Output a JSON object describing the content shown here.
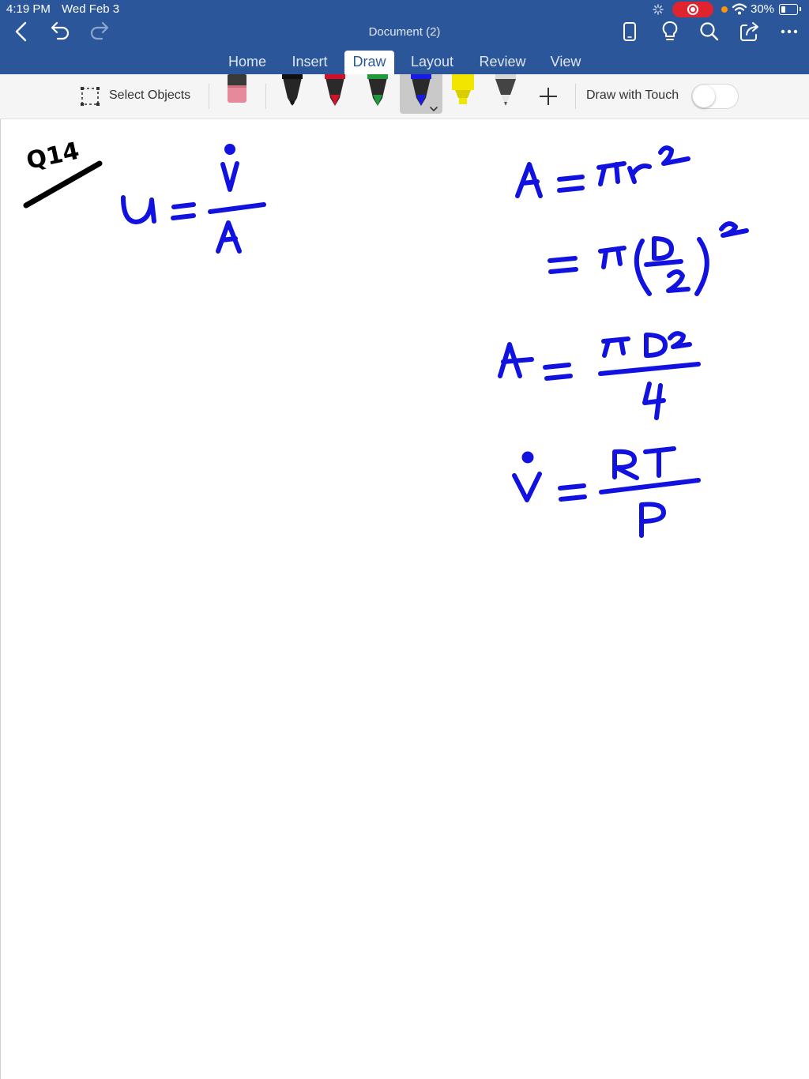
{
  "status_bar": {
    "time": "4:19 PM",
    "date": "Wed Feb 3",
    "battery": "30%",
    "battery_level": 0.3,
    "recording_color": "#e0242f"
  },
  "header": {
    "title": "Document (2)",
    "ribbon_color": "#2b579a",
    "tabs": [
      {
        "label": "Home"
      },
      {
        "label": "Insert"
      },
      {
        "label": "Draw",
        "active": true
      },
      {
        "label": "Layout"
      },
      {
        "label": "Review"
      },
      {
        "label": "View"
      }
    ]
  },
  "toolbar": {
    "select_objects": "Select Objects",
    "draw_with_touch": "Draw with Touch",
    "draw_with_touch_on": false,
    "tools": [
      {
        "name": "eraser",
        "color": "#e68a9b"
      },
      {
        "name": "pen-black",
        "color": "#111111"
      },
      {
        "name": "pen-red",
        "color": "#d0112b"
      },
      {
        "name": "pen-green",
        "color": "#1f9a3b"
      },
      {
        "name": "pen-blue",
        "color": "#1a1ae6",
        "selected": true
      },
      {
        "name": "highlighter-yellow",
        "color": "#f2e600"
      },
      {
        "name": "pencil-gray",
        "color": "#555555"
      }
    ]
  },
  "ink": {
    "question_label": "Q14",
    "eq1": "u = V̇ / A",
    "eq2": "A = πr²",
    "eq3": "= π(D/2)²",
    "eq4": "A = πD² / 4",
    "eq5": "V̇ = RT / P",
    "ink_color": "#1212e0",
    "label_color": "#000000"
  }
}
